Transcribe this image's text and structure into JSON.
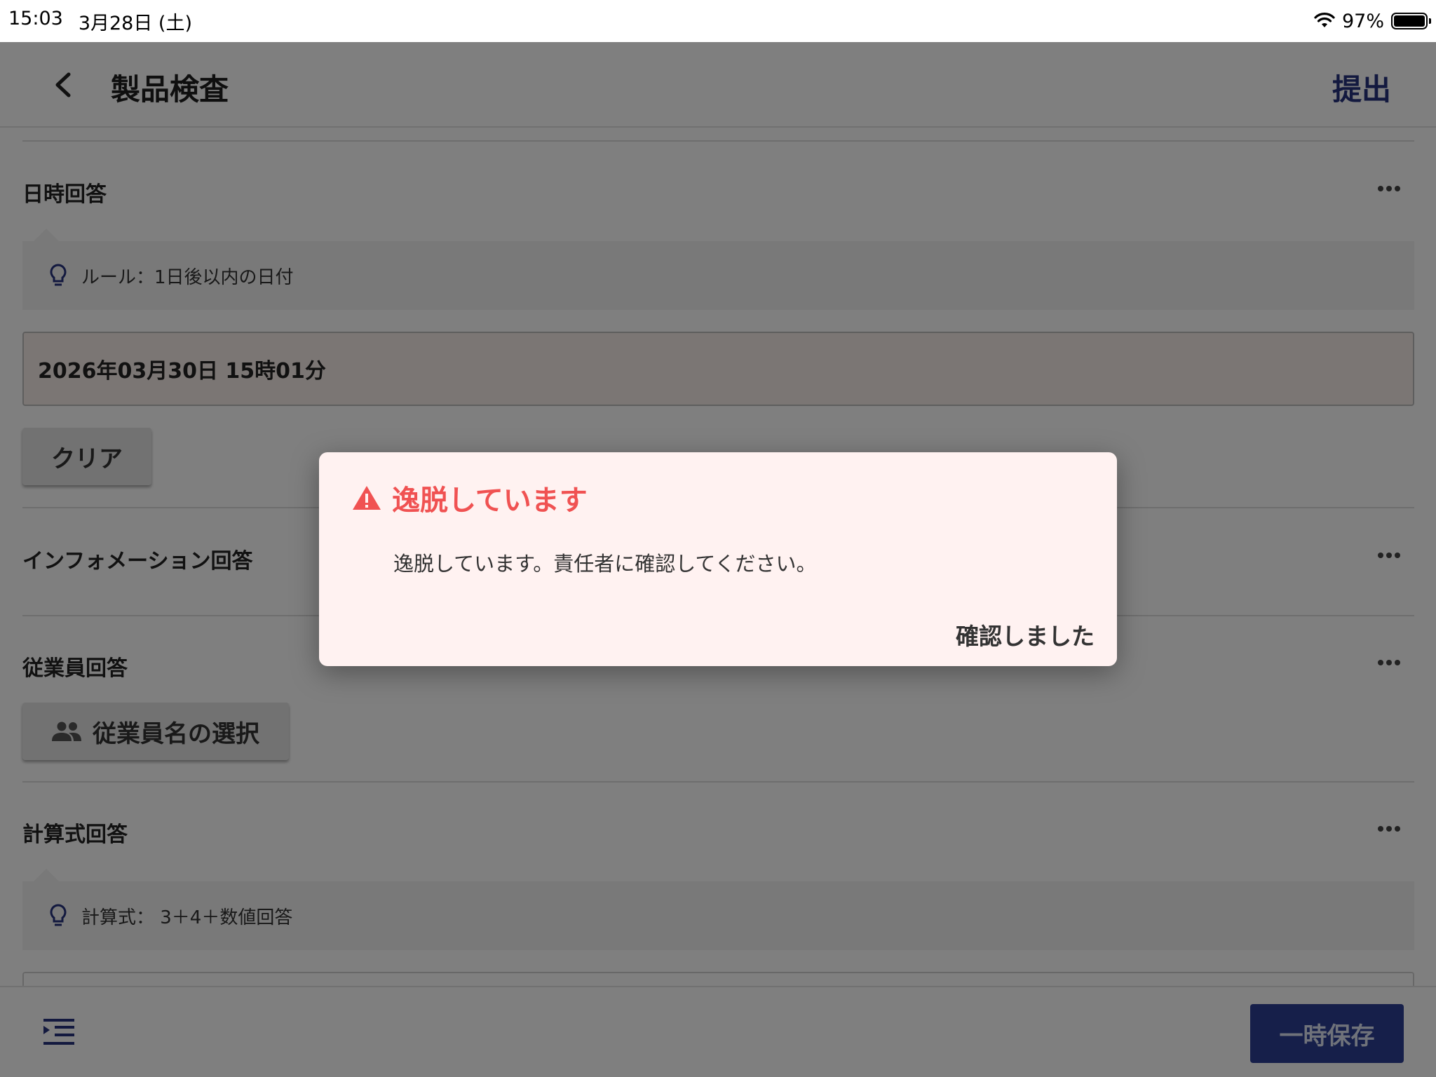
{
  "status_bar": {
    "time": "15:03",
    "date": "3月28日 (土)",
    "battery": "97%"
  },
  "header": {
    "title": "製品検査",
    "submit_label": "提出"
  },
  "questions": {
    "datetime": {
      "title": "日時回答",
      "rule": "ルール：1日後以内の日付",
      "value": "2026年03月30日 15時01分",
      "clear_label": "クリア"
    },
    "information": {
      "title": "インフォメーション回答"
    },
    "employee": {
      "title": "従業員回答",
      "select_label": "従業員名の選択"
    },
    "formula": {
      "title": "計算式回答",
      "hint": "計算式： 3＋4＋数値回答"
    }
  },
  "footer": {
    "save_label": "一時保存"
  },
  "dialog": {
    "title": "逸脱しています",
    "message": "逸脱しています。責任者に確認してください。",
    "confirm_label": "確認しました"
  },
  "colors": {
    "accent": "#26337f",
    "warning": "#f05252",
    "save_button": "#2c3f95"
  },
  "icons": [
    "back-arrow-icon",
    "wifi-icon",
    "battery-icon",
    "more-horizontal-icon",
    "lightbulb-icon",
    "people-icon",
    "outline-indent-icon",
    "warning-triangle-icon"
  ]
}
